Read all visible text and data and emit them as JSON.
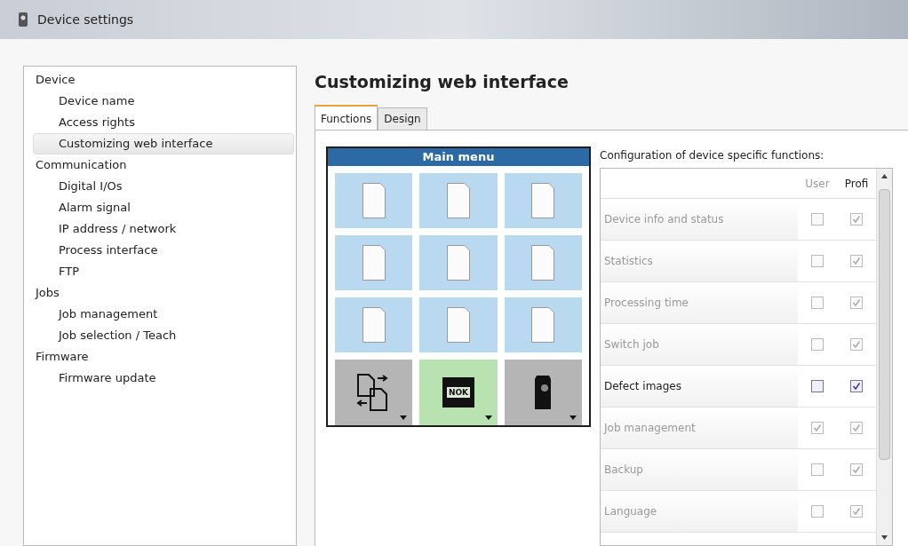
{
  "window": {
    "title": "Device settings"
  },
  "sidebar": {
    "items": [
      {
        "label": "Device",
        "selected": false,
        "children": [
          {
            "label": "Device name",
            "selected": false
          },
          {
            "label": "Access rights",
            "selected": false
          },
          {
            "label": "Customizing web interface",
            "selected": true
          }
        ]
      },
      {
        "label": "Communication",
        "selected": false,
        "children": [
          {
            "label": "Digital I/Os",
            "selected": false
          },
          {
            "label": "Alarm signal",
            "selected": false
          },
          {
            "label": "IP address / network",
            "selected": false
          },
          {
            "label": "Process interface",
            "selected": false
          },
          {
            "label": "FTP",
            "selected": false
          }
        ]
      },
      {
        "label": "Jobs",
        "selected": false,
        "children": [
          {
            "label": "Job management",
            "selected": false
          },
          {
            "label": "Job selection / Teach",
            "selected": false
          }
        ]
      },
      {
        "label": "Firmware",
        "selected": false,
        "children": [
          {
            "label": "Firmware update",
            "selected": false
          }
        ]
      }
    ]
  },
  "heading": "Customizing web interface",
  "tabs": [
    {
      "label": "Functions",
      "selected": true
    },
    {
      "label": "Design",
      "selected": false
    }
  ],
  "main_menu": {
    "title": "Main menu",
    "tiles": [
      {
        "kind": "page"
      },
      {
        "kind": "page"
      },
      {
        "kind": "page"
      },
      {
        "kind": "page"
      },
      {
        "kind": "page"
      },
      {
        "kind": "page"
      },
      {
        "kind": "page"
      },
      {
        "kind": "page"
      },
      {
        "kind": "page"
      },
      {
        "kind": "transfer",
        "highlighted": false
      },
      {
        "kind": "nok",
        "highlighted": true,
        "text": "NOK"
      },
      {
        "kind": "device",
        "highlighted": false
      }
    ]
  },
  "functions": {
    "label": "Configuration of device specific functions:",
    "columns": [
      "User",
      "Profi"
    ],
    "rows": [
      {
        "label": "Device info and status",
        "enabled": false,
        "user": false,
        "profi": true
      },
      {
        "label": "Statistics",
        "enabled": false,
        "user": false,
        "profi": true
      },
      {
        "label": "Processing time",
        "enabled": false,
        "user": false,
        "profi": true
      },
      {
        "label": "Switch job",
        "enabled": false,
        "user": false,
        "profi": true
      },
      {
        "label": "Defect images",
        "enabled": true,
        "user": false,
        "profi": true
      },
      {
        "label": "Job management",
        "enabled": false,
        "user": true,
        "profi": true
      },
      {
        "label": "Backup",
        "enabled": false,
        "user": false,
        "profi": true
      },
      {
        "label": "Language",
        "enabled": false,
        "user": false,
        "profi": true
      }
    ]
  }
}
